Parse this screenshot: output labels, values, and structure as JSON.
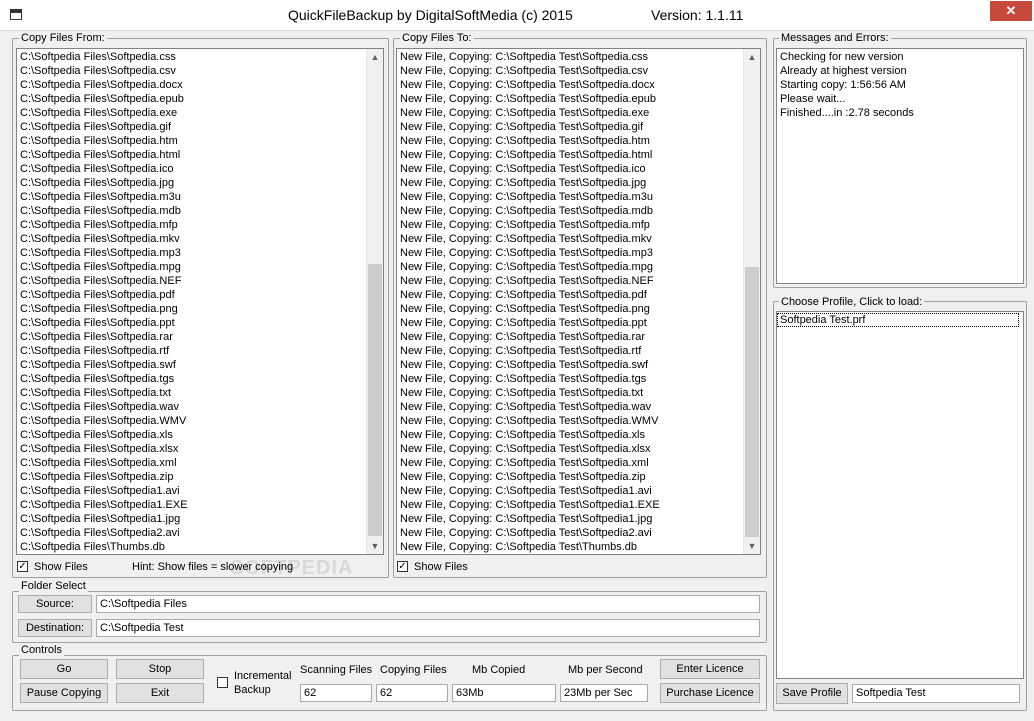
{
  "window": {
    "title": "QuickFileBackup by DigitalSoftMedia (c) 2015",
    "version": "Version: 1.1.11",
    "close_glyph": "✕"
  },
  "source_panel": {
    "label": "Copy Files From:",
    "items": [
      "C:\\Softpedia Files\\Softpedia.css",
      "C:\\Softpedia Files\\Softpedia.csv",
      "C:\\Softpedia Files\\Softpedia.docx",
      "C:\\Softpedia Files\\Softpedia.epub",
      "C:\\Softpedia Files\\Softpedia.exe",
      "C:\\Softpedia Files\\Softpedia.gif",
      "C:\\Softpedia Files\\Softpedia.htm",
      "C:\\Softpedia Files\\Softpedia.html",
      "C:\\Softpedia Files\\Softpedia.ico",
      "C:\\Softpedia Files\\Softpedia.jpg",
      "C:\\Softpedia Files\\Softpedia.m3u",
      "C:\\Softpedia Files\\Softpedia.mdb",
      "C:\\Softpedia Files\\Softpedia.mfp",
      "C:\\Softpedia Files\\Softpedia.mkv",
      "C:\\Softpedia Files\\Softpedia.mp3",
      "C:\\Softpedia Files\\Softpedia.mpg",
      "C:\\Softpedia Files\\Softpedia.NEF",
      "C:\\Softpedia Files\\Softpedia.pdf",
      "C:\\Softpedia Files\\Softpedia.png",
      "C:\\Softpedia Files\\Softpedia.ppt",
      "C:\\Softpedia Files\\Softpedia.rar",
      "C:\\Softpedia Files\\Softpedia.rtf",
      "C:\\Softpedia Files\\Softpedia.swf",
      "C:\\Softpedia Files\\Softpedia.tgs",
      "C:\\Softpedia Files\\Softpedia.txt",
      "C:\\Softpedia Files\\Softpedia.wav",
      "C:\\Softpedia Files\\Softpedia.WMV",
      "C:\\Softpedia Files\\Softpedia.xls",
      "C:\\Softpedia Files\\Softpedia.xlsx",
      "C:\\Softpedia Files\\Softpedia.xml",
      "C:\\Softpedia Files\\Softpedia.zip",
      "C:\\Softpedia Files\\Softpedia1.avi",
      "C:\\Softpedia Files\\Softpedia1.EXE",
      "C:\\Softpedia Files\\Softpedia1.jpg",
      "C:\\Softpedia Files\\Softpedia2.avi",
      "C:\\Softpedia Files\\Thumbs.db"
    ],
    "show_files_label": "Show Files",
    "show_files_checked": true,
    "hint": "Hint: Show files = slower copying"
  },
  "dest_panel": {
    "label": "Copy Files To:",
    "items": [
      "New File, Copying: C:\\Softpedia Test\\Softpedia.css",
      "New File, Copying: C:\\Softpedia Test\\Softpedia.csv",
      "New File, Copying: C:\\Softpedia Test\\Softpedia.docx",
      "New File, Copying: C:\\Softpedia Test\\Softpedia.epub",
      "New File, Copying: C:\\Softpedia Test\\Softpedia.exe",
      "New File, Copying: C:\\Softpedia Test\\Softpedia.gif",
      "New File, Copying: C:\\Softpedia Test\\Softpedia.htm",
      "New File, Copying: C:\\Softpedia Test\\Softpedia.html",
      "New File, Copying: C:\\Softpedia Test\\Softpedia.ico",
      "New File, Copying: C:\\Softpedia Test\\Softpedia.jpg",
      "New File, Copying: C:\\Softpedia Test\\Softpedia.m3u",
      "New File, Copying: C:\\Softpedia Test\\Softpedia.mdb",
      "New File, Copying: C:\\Softpedia Test\\Softpedia.mfp",
      "New File, Copying: C:\\Softpedia Test\\Softpedia.mkv",
      "New File, Copying: C:\\Softpedia Test\\Softpedia.mp3",
      "New File, Copying: C:\\Softpedia Test\\Softpedia.mpg",
      "New File, Copying: C:\\Softpedia Test\\Softpedia.NEF",
      "New File, Copying: C:\\Softpedia Test\\Softpedia.pdf",
      "New File, Copying: C:\\Softpedia Test\\Softpedia.png",
      "New File, Copying: C:\\Softpedia Test\\Softpedia.ppt",
      "New File, Copying: C:\\Softpedia Test\\Softpedia.rar",
      "New File, Copying: C:\\Softpedia Test\\Softpedia.rtf",
      "New File, Copying: C:\\Softpedia Test\\Softpedia.swf",
      "New File, Copying: C:\\Softpedia Test\\Softpedia.tgs",
      "New File, Copying: C:\\Softpedia Test\\Softpedia.txt",
      "New File, Copying: C:\\Softpedia Test\\Softpedia.wav",
      "New File, Copying: C:\\Softpedia Test\\Softpedia.WMV",
      "New File, Copying: C:\\Softpedia Test\\Softpedia.xls",
      "New File, Copying: C:\\Softpedia Test\\Softpedia.xlsx",
      "New File, Copying: C:\\Softpedia Test\\Softpedia.xml",
      "New File, Copying: C:\\Softpedia Test\\Softpedia.zip",
      "New File, Copying: C:\\Softpedia Test\\Softpedia1.avi",
      "New File, Copying: C:\\Softpedia Test\\Softpedia1.EXE",
      "New File, Copying: C:\\Softpedia Test\\Softpedia1.jpg",
      "New File, Copying: C:\\Softpedia Test\\Softpedia2.avi",
      "New File, Copying: C:\\Softpedia Test\\Thumbs.db"
    ],
    "show_files_label": "Show Files",
    "show_files_checked": true
  },
  "messages": {
    "label": "Messages and Errors:",
    "items": [
      "Checking for new version",
      "Already at highest version",
      "Starting copy: 1:56:56 AM",
      "Please wait...",
      "Finished....in :2.78 seconds"
    ]
  },
  "profiles": {
    "label": "Choose Profile, Click to load:",
    "items": [
      "Softpedia Test.prf"
    ],
    "save_button": "Save Profile",
    "profile_name": "Softpedia Test"
  },
  "folder_select": {
    "label": "Folder Select",
    "source_button": "Source:",
    "source_path": "C:\\Softpedia Files",
    "dest_button": "Destination:",
    "dest_path": "C:\\Softpedia Test"
  },
  "controls": {
    "label": "Controls",
    "go": "Go",
    "stop": "Stop",
    "pause": "Pause Copying",
    "exit": "Exit",
    "incremental_line1": "Incremental",
    "incremental_line2": "Backup",
    "incremental_checked": false,
    "scanning_label": "Scanning Files",
    "scanning_value": "62",
    "copying_label": "Copying Files",
    "copying_value": "62",
    "mb_label": "Mb Copied",
    "mb_value": "63Mb",
    "mbps_label": "Mb per Second",
    "mbps_value": "23Mb per Sec",
    "enter_licence": "Enter Licence",
    "purchase_licence": "Purchase Licence"
  }
}
